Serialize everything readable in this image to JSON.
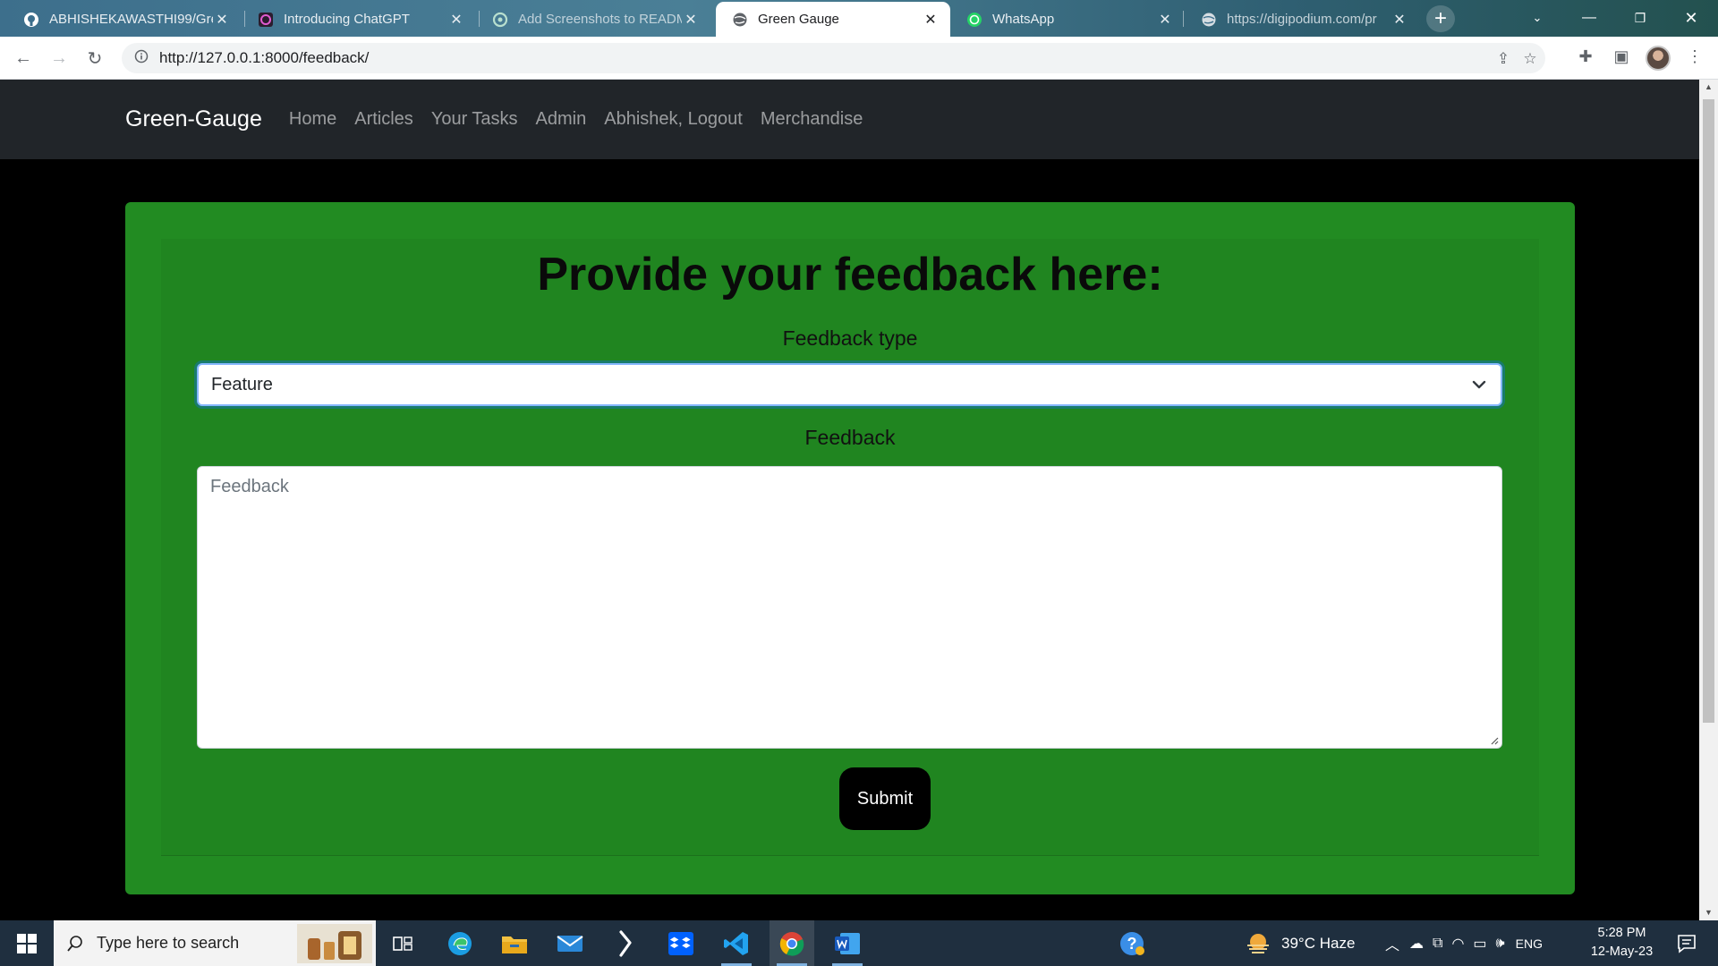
{
  "browser": {
    "tabs": [
      {
        "title": "ABHISHEKAWASTHI99/Gre",
        "icon": "github-icon"
      },
      {
        "title": "Introducing ChatGPT",
        "icon": "openai-icon"
      },
      {
        "title": "Add Screenshots to READM",
        "icon": "chatgpt-icon"
      },
      {
        "title": "Green Gauge",
        "icon": "globe-icon",
        "active": true
      },
      {
        "title": "WhatsApp",
        "icon": "whatsapp-icon"
      },
      {
        "title": "https://digipodium.com/pr",
        "icon": "globe-icon"
      }
    ],
    "url": "http://127.0.0.1:8000/feedback/"
  },
  "navbar": {
    "brand": "Green-Gauge",
    "links": [
      "Home",
      "Articles",
      "Your Tasks",
      "Admin",
      "Abhishek, Logout",
      "Merchandise"
    ]
  },
  "form": {
    "heading": "Provide your feedback here:",
    "type_label": "Feedback type",
    "type_value": "Feature",
    "feedback_label": "Feedback",
    "feedback_placeholder": "Feedback",
    "submit_label": "Submit"
  },
  "colors": {
    "card": "#228b22",
    "navbar": "#212529",
    "page_bg": "#000000"
  },
  "taskbar": {
    "search_placeholder": "Type here to search",
    "weather": "39°C  Haze",
    "language": "ENG",
    "time": "5:28 PM",
    "date": "12-May-23"
  }
}
